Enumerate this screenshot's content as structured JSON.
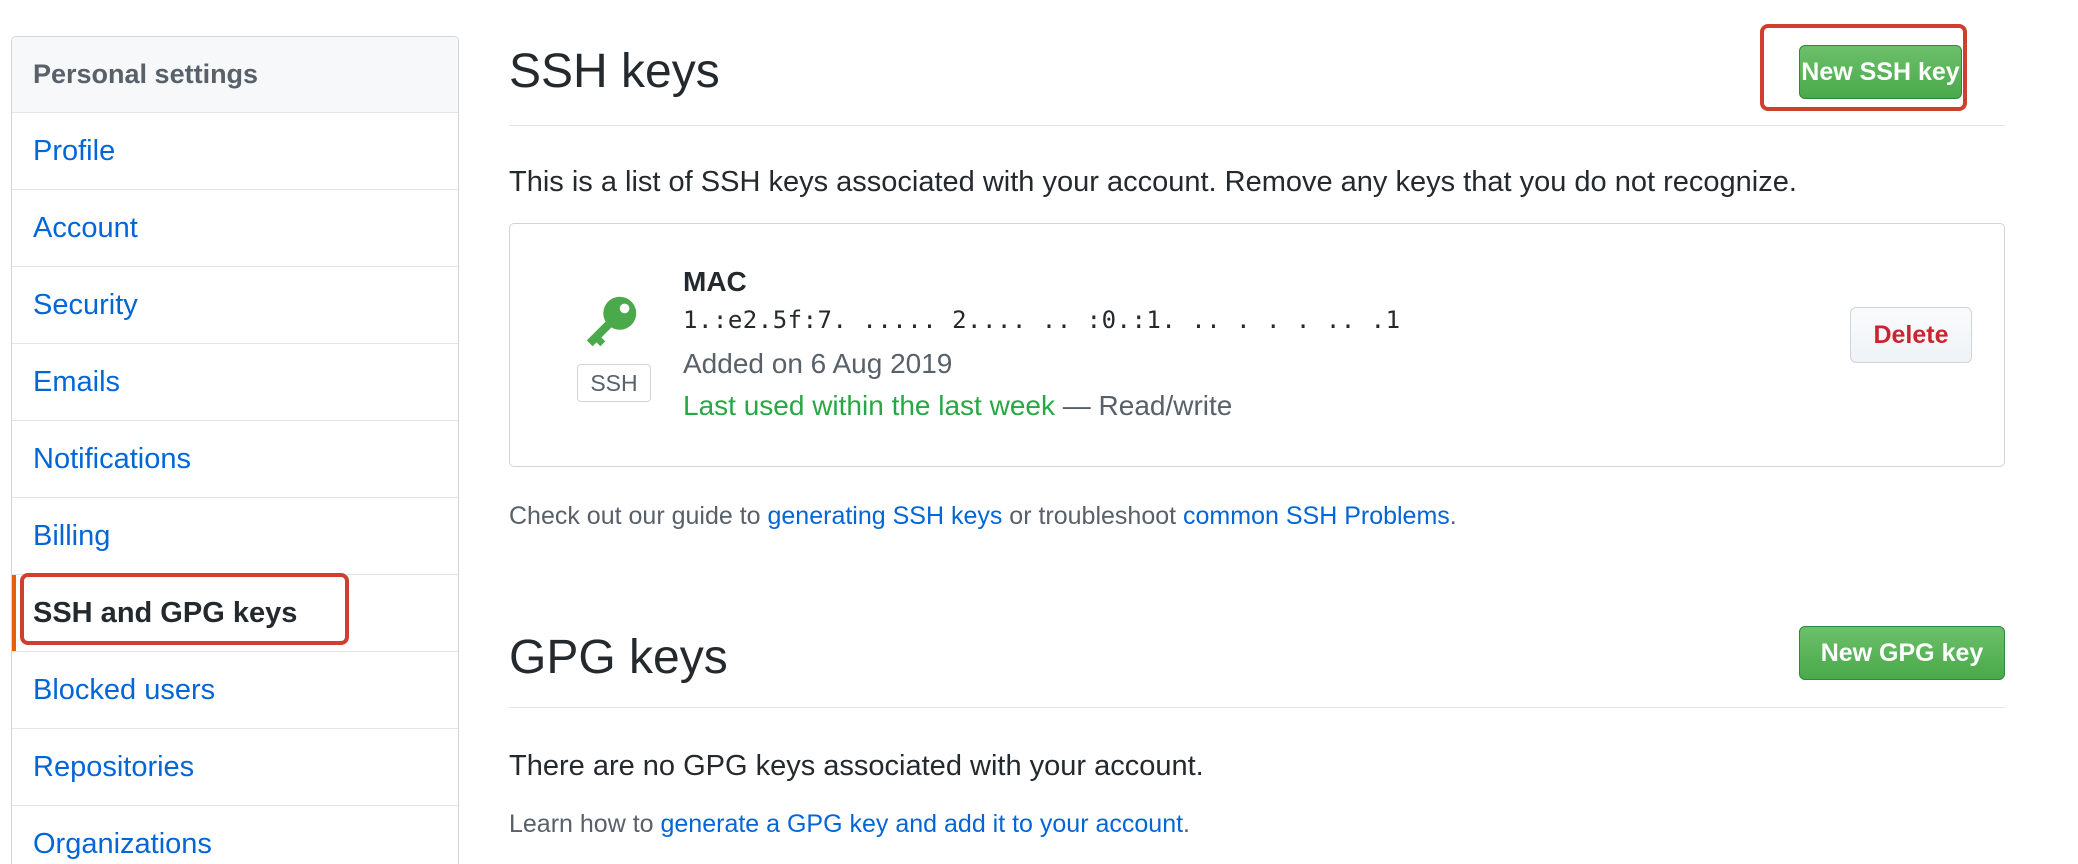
{
  "sidebar": {
    "header": "Personal settings",
    "items": [
      {
        "label": "Profile"
      },
      {
        "label": "Account"
      },
      {
        "label": "Security"
      },
      {
        "label": "Emails"
      },
      {
        "label": "Notifications"
      },
      {
        "label": "Billing"
      },
      {
        "label": "SSH and GPG keys"
      },
      {
        "label": "Blocked users"
      },
      {
        "label": "Repositories"
      },
      {
        "label": "Organizations"
      }
    ],
    "selected": "SSH and GPG keys"
  },
  "ssh": {
    "title": "SSH keys",
    "new_button": "New SSH key",
    "description": "This is a list of SSH keys associated with your account. Remove any keys that you do not recognize.",
    "key": {
      "icon": "key-icon",
      "tag": "SSH",
      "name": "MAC",
      "fingerprint": "1.:e2.5f:7. ..... 2.... .. :0.:1. .. . . . .. .1",
      "added": "Added on 6 Aug 2019",
      "last_used": "Last used within the last week",
      "access": " — Read/write",
      "delete_label": "Delete"
    },
    "guide": {
      "prefix": "Check out our guide to ",
      "link1": "generating SSH keys",
      "middle": " or troubleshoot ",
      "link2": "common SSH Problems",
      "suffix": "."
    }
  },
  "gpg": {
    "title": "GPG keys",
    "new_button": "New GPG key",
    "empty": "There are no GPG keys associated with your account.",
    "learn": {
      "prefix": "Learn how to ",
      "link": "generate a GPG key and add it to your account",
      "suffix": "."
    }
  },
  "colors": {
    "link": "#0366d6",
    "green_button": "#4aa94a",
    "highlight": "#cf3f2e",
    "key_icon": "#4aa94a",
    "delete": "#cb2431"
  }
}
